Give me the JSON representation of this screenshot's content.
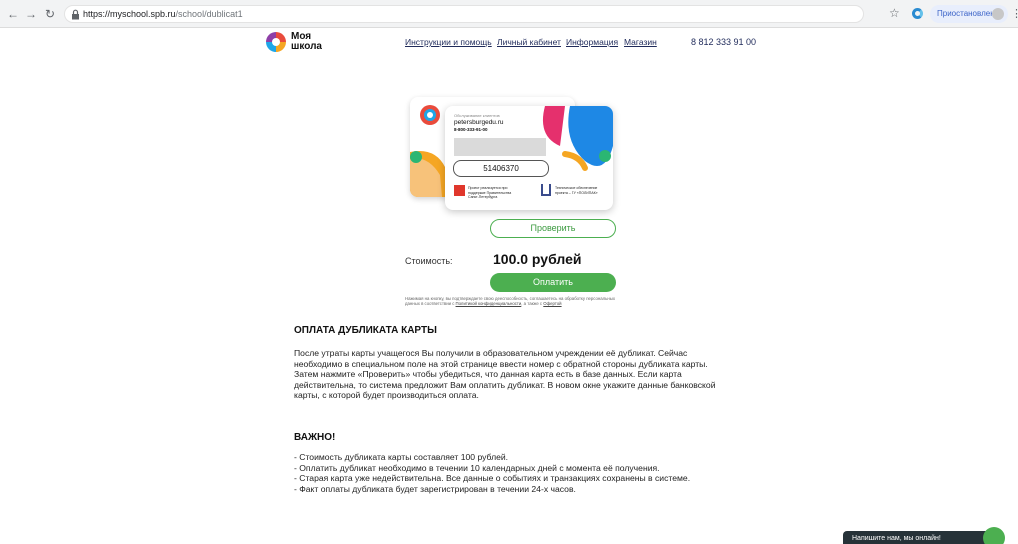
{
  "browser": {
    "url_host": "https://myschool.spb.ru",
    "url_path": "/school/dublicat1",
    "profile_label": "Приостановлена"
  },
  "header": {
    "logo_text": "Моя школа",
    "nav": [
      "Инструкции и помощь",
      "Личный кабинет",
      "Информация",
      "Магазин"
    ],
    "phone": "8 812 333 91 00"
  },
  "card": {
    "small_label": "Обслуживание клиентов",
    "site": "petersburgedu.ru",
    "phone": "8-800-333-91-00",
    "number": "51406370",
    "project_text": "Проект реализуется при поддержке Правительства Санкт-Петербурга",
    "tech_text": "Техническое обеспечение проекта – ГУ «ПОЛИПАК»"
  },
  "form": {
    "check_label": "Проверить",
    "cost_label": "Стоимость:",
    "cost_value": "100.0 рублей",
    "pay_label": "Оплатить",
    "consent_text": "Нажимая на кнопку, вы подтверждаете свою дееспособность, соглашаетесь на обработку персональных данных в соответствии с",
    "policy_link": "Политикой конфиденциальности",
    "consent_mid": ", а также с",
    "offer_link": "Офертой"
  },
  "content": {
    "title": "ОПЛАТА ДУБЛИКАТА КАРТЫ",
    "paragraph": "После утраты карты учащегося Вы получили в образовательном учреждении её дубликат. Сейчас необходимо в специальном поле на этой странице ввести номер с обратной стороны дубликата карты. Затем нажмите «Проверить» чтобы убедиться, что данная карта есть в базе данных. Если карта действительна, то система предложит Вам оплатить дубликат. В новом окне укажите данные банковской карты, с которой будет производиться оплата.",
    "important_title": "ВАЖНО!",
    "important_items": [
      "- Стоимость дубликата карты составляет 100 рублей.",
      "- Оплатить дубликат необходимо в течении 10 календарных дней с момента её получения.",
      "- Старая карта уже недействительна. Все данные о событиях и транзакциях сохранены в системе.",
      "- Факт оплаты дубликата будет зарегистрирован в течении 24-х часов."
    ]
  },
  "chat": {
    "label": "Напишите нам, мы онлайн!"
  },
  "colors": {
    "accent_green": "#4caf50",
    "nav_text": "#1f2a5a"
  }
}
